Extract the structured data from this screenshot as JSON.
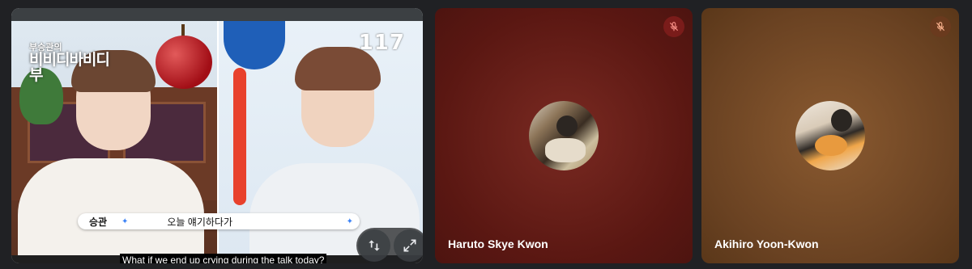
{
  "video": {
    "show_logo_line1": "부승관의",
    "show_logo_line2": "비비디바비디부",
    "channel_logo": "117",
    "caption": {
      "speaker": "승관",
      "text": "오늘 얘기하다가"
    },
    "subtitle": "What if we end up crying during the talk today?",
    "controls": [
      {
        "icon": "swap-vertical-icon"
      },
      {
        "icon": "fullscreen-icon"
      }
    ]
  },
  "participants": [
    {
      "name": "Haruto Skye Kwon",
      "muted_icon": "mic-off-icon",
      "color": "#5a1712"
    },
    {
      "name": "Akihiro Yoon-Kwon",
      "muted_icon": "mic-off-icon",
      "color": "#6a4222"
    }
  ]
}
